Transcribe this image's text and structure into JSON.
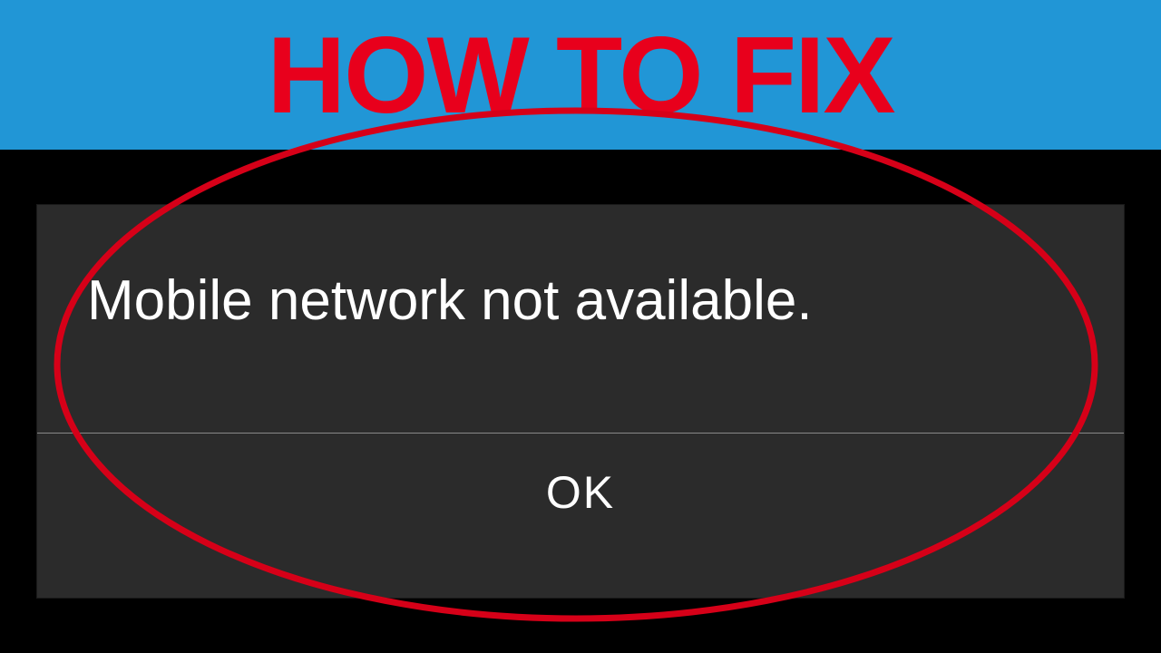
{
  "header": {
    "title": "HOW TO FIX"
  },
  "dialog": {
    "message": "Mobile network not available.",
    "ok_label": "OK"
  },
  "annotation": {
    "ellipse_color": "#d60018"
  }
}
